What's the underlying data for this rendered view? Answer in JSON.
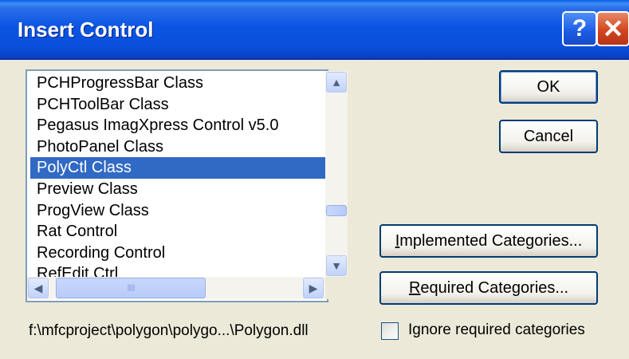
{
  "window": {
    "title": "Insert Control",
    "help_label": "?",
    "close_label": "✕"
  },
  "controls": [
    {
      "label": "PCHProgressBar Class"
    },
    {
      "label": "PCHToolBar Class"
    },
    {
      "label": "Pegasus ImagXpress Control v5.0"
    },
    {
      "label": "PhotoPanel Class"
    },
    {
      "label": "PolyCtl Class",
      "selected": true
    },
    {
      "label": "Preview Class"
    },
    {
      "label": "ProgView Class"
    },
    {
      "label": "Rat Control"
    },
    {
      "label": "Recording Control"
    },
    {
      "label": "RefEdit.Ctrl"
    }
  ],
  "buttons": {
    "ok": "OK",
    "cancel": "Cancel",
    "implemented_prefix": "I",
    "implemented_rest": "mplemented Categories...",
    "required_prefix": "R",
    "required_rest": "equired Categories..."
  },
  "footer": {
    "path": "f:\\mfcproject\\polygon\\polygo...\\Polygon.dll",
    "ignore_label": "Ignore required categories",
    "ignore_checked": false
  },
  "icons": {
    "scroll_up": "▲",
    "scroll_down": "▼",
    "scroll_left": "◀",
    "scroll_right": "▶",
    "grip": "IIII"
  },
  "colors": {
    "title_bar": "#0A55E3",
    "selection": "#316AC5",
    "close_button": "#D2461E",
    "dialog_bg": "#ECE9D8"
  }
}
